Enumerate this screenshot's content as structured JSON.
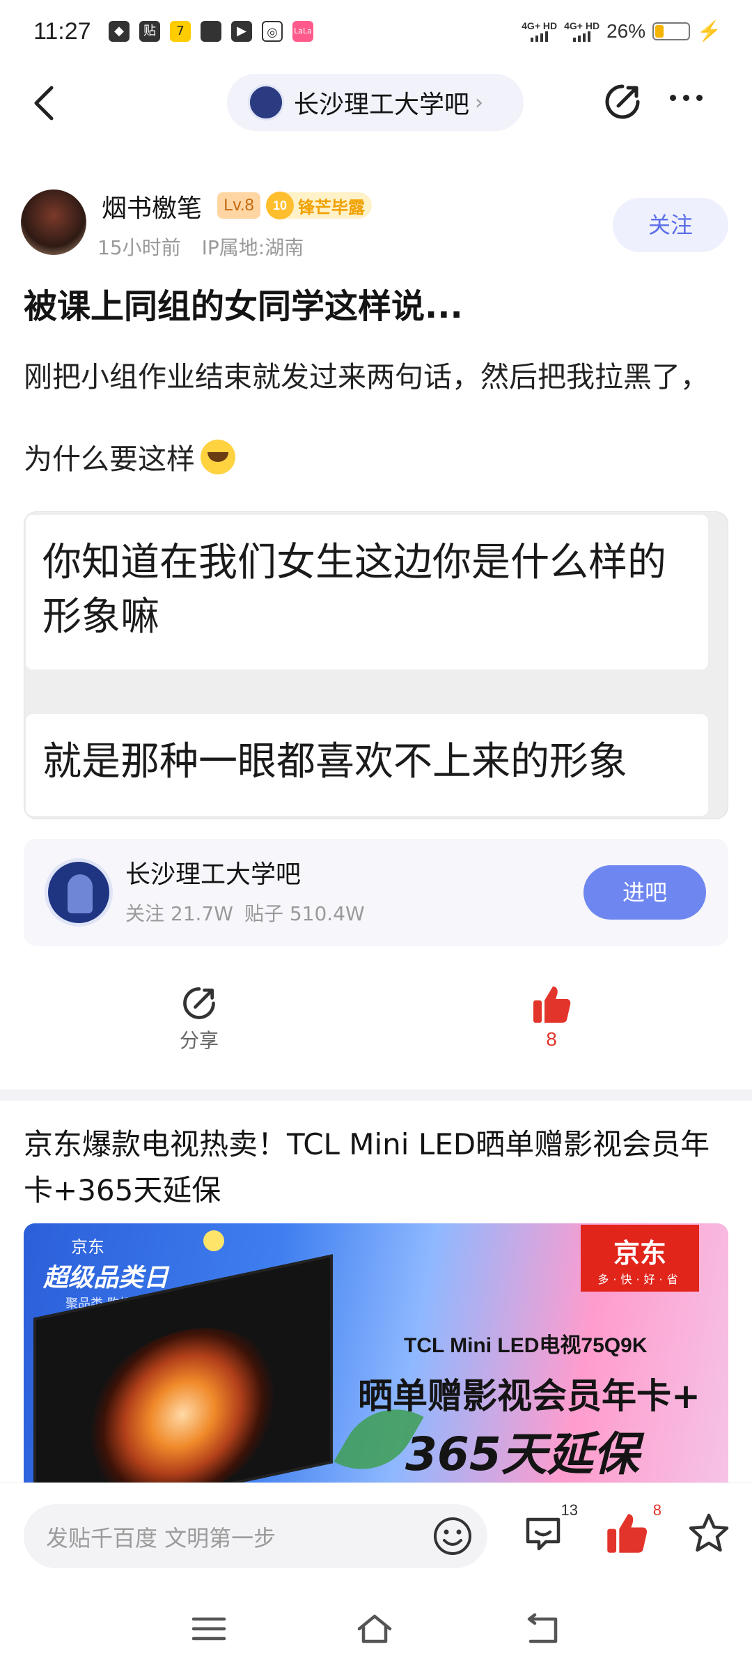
{
  "status_bar": {
    "time": "11:27",
    "net1": "4G+ HD",
    "net2": "4G+ HD",
    "battery": "26%",
    "battery_level": 0.26,
    "notification_icons": [
      "qq-icon",
      "tieba-icon",
      "duck-icon",
      "square-icon",
      "video-icon",
      "weibo-icon",
      "lalala-icon"
    ]
  },
  "nav": {
    "forum_name": "长沙理工大学吧"
  },
  "post": {
    "author": "烟书檄笔",
    "level": "Lv.8",
    "honor_level": "10",
    "honor_title": "锋芒毕露",
    "time": "15小时前",
    "ip": "IP属地:湖南",
    "follow_label": "关注",
    "title": "被课上同组的女同学这样说...",
    "body": "刚把小组作业结束就发过来两句话，然后把我拉黑了，为什么要这样",
    "image_text_1": "你知道在我们女生这边你是什么样的形象嘛",
    "image_text_2": "就是那种一眼都喜欢不上来的形象"
  },
  "forum_card": {
    "name": "长沙理工大学吧",
    "followers": "关注 21.7W",
    "posts": "贴子 510.4W",
    "enter_label": "进吧"
  },
  "actions": {
    "share_label": "分享",
    "like_count": "8"
  },
  "ad": {
    "title": "京东爆款电视热卖！TCL Mini LED晒单赠影视会员年卡+365天延保",
    "tag_top": "京东",
    "tag_main": "超级品类日",
    "tag_sub": "聚品类 购好物",
    "brand": "京东",
    "brand_sub": "多·快·好·省",
    "model": "TCL Mini LED电视75Q9K",
    "slogan_1": "晒单赠影视会员年卡+",
    "slogan_2": "365天延保"
  },
  "bottom_bar": {
    "input_placeholder": "发贴千百度 文明第一步",
    "comment_count": "13",
    "like_count": "8"
  },
  "colors": {
    "accent": "#5b6ee8",
    "enter_button": "#6e86f0",
    "like_red": "#e2342b",
    "honor_gold": "#f0a100",
    "jd_red": "#e1251b"
  }
}
